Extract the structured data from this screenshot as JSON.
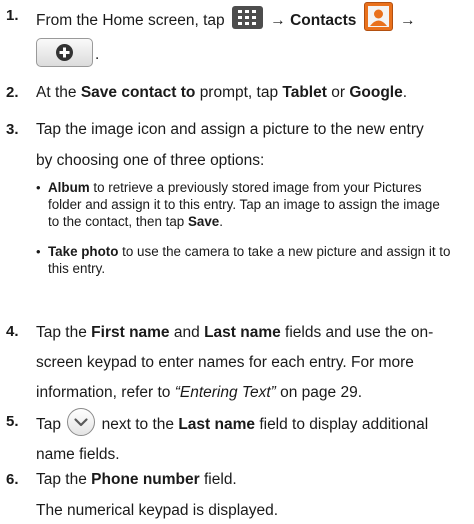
{
  "steps": [
    {
      "num": "1.",
      "t_a": "From the Home screen, tap",
      "t_b": "→",
      "t_c": "Contacts",
      "t_d": "→",
      "t_e": "."
    },
    {
      "num": "2.",
      "t_a": "At the",
      "t_b": "Save contact to",
      "t_c": "prompt, tap",
      "t_d": "Tablet",
      "t_e": "or",
      "t_f": "Google",
      "t_g": "."
    },
    {
      "num": "3.",
      "line1": "Tap the image icon and assign a picture to the new entry",
      "line2": "by choosing one of three options:"
    },
    {
      "num": "4.",
      "t_a": "Tap the",
      "t_b": "First name",
      "t_c": "and",
      "t_d": "Last name",
      "t_e": "fields and use the on-",
      "line2": "screen keypad to enter names for each entry. For more",
      "t_f": "information, refer to",
      "t_g": "“Entering Text”",
      "t_h": "on page 29."
    },
    {
      "num": "5.",
      "t_a": "Tap",
      "t_b": "next to the",
      "t_c": "Last name",
      "t_d": "field to display additional",
      "line2": "name fields."
    },
    {
      "num": "6.",
      "t_a": "Tap the",
      "t_b": "Phone number",
      "t_c": "field.",
      "line2": "The numerical keypad is displayed."
    }
  ],
  "bullets": [
    {
      "bold": "Album",
      "t1": "to retrieve a previously stored image from your Pictures",
      "line2": "folder and assign it to this entry. Tap an image to assign the image",
      "t3": "to the contact, then tap",
      "bold2": "Save",
      "t4": "."
    },
    {
      "bold": "Take photo",
      "t1": "to use the camera to take a new picture and assign it to",
      "line2": "this entry."
    }
  ],
  "colors": {
    "contacts_icon": "#e9711c",
    "grid_icon": "#4d4d4d"
  },
  "icons": [
    "apps-grid-icon",
    "contacts-icon",
    "add-contact-icon",
    "expand-chevron-icon"
  ]
}
